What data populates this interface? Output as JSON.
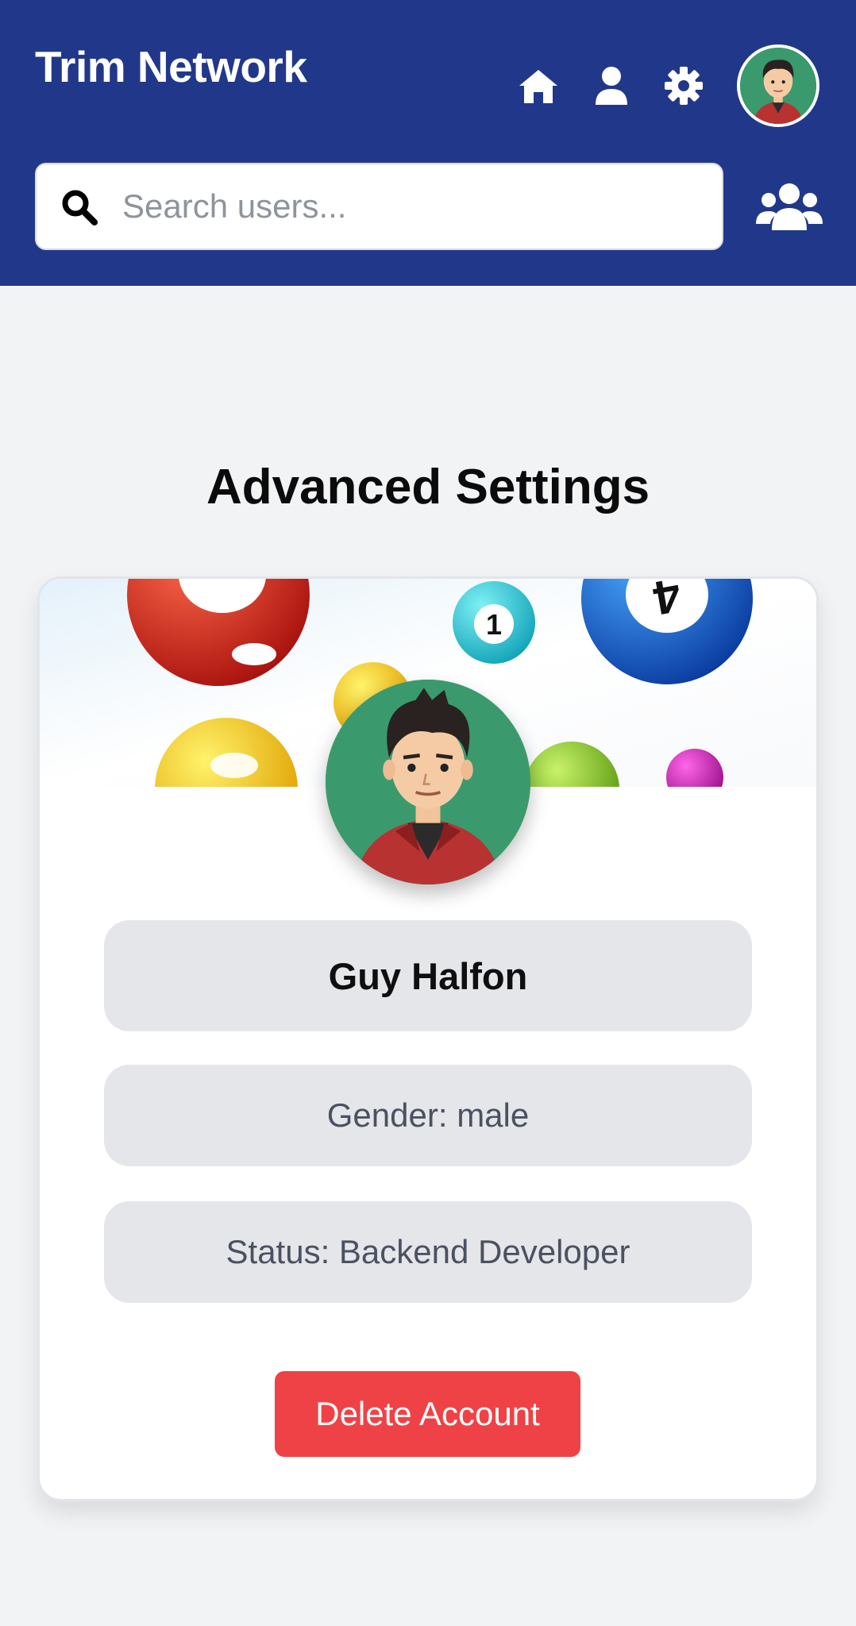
{
  "header": {
    "brand": "Trim Network",
    "nav": [
      {
        "name": "home",
        "icon": "home-icon"
      },
      {
        "name": "profile",
        "icon": "user-icon"
      },
      {
        "name": "settings",
        "icon": "gear-icon"
      }
    ],
    "avatar_icon": "avatar"
  },
  "search": {
    "placeholder": "Search users...",
    "value": "",
    "icon": "search-icon",
    "users_icon": "users-icon"
  },
  "page": {
    "title": "Advanced Settings"
  },
  "profile": {
    "name": "Guy Halfon",
    "gender": "Gender: male",
    "status": "Status: Backend Developer",
    "delete_label": "Delete Account"
  },
  "cover_balls": [
    "1",
    "4"
  ],
  "colors": {
    "header_bg": "#21388a",
    "page_bg": "#f2f3f5",
    "danger": "#ef4246",
    "pill_bg": "#e5e6ea",
    "avatar_bg": "#3a9a6e"
  }
}
